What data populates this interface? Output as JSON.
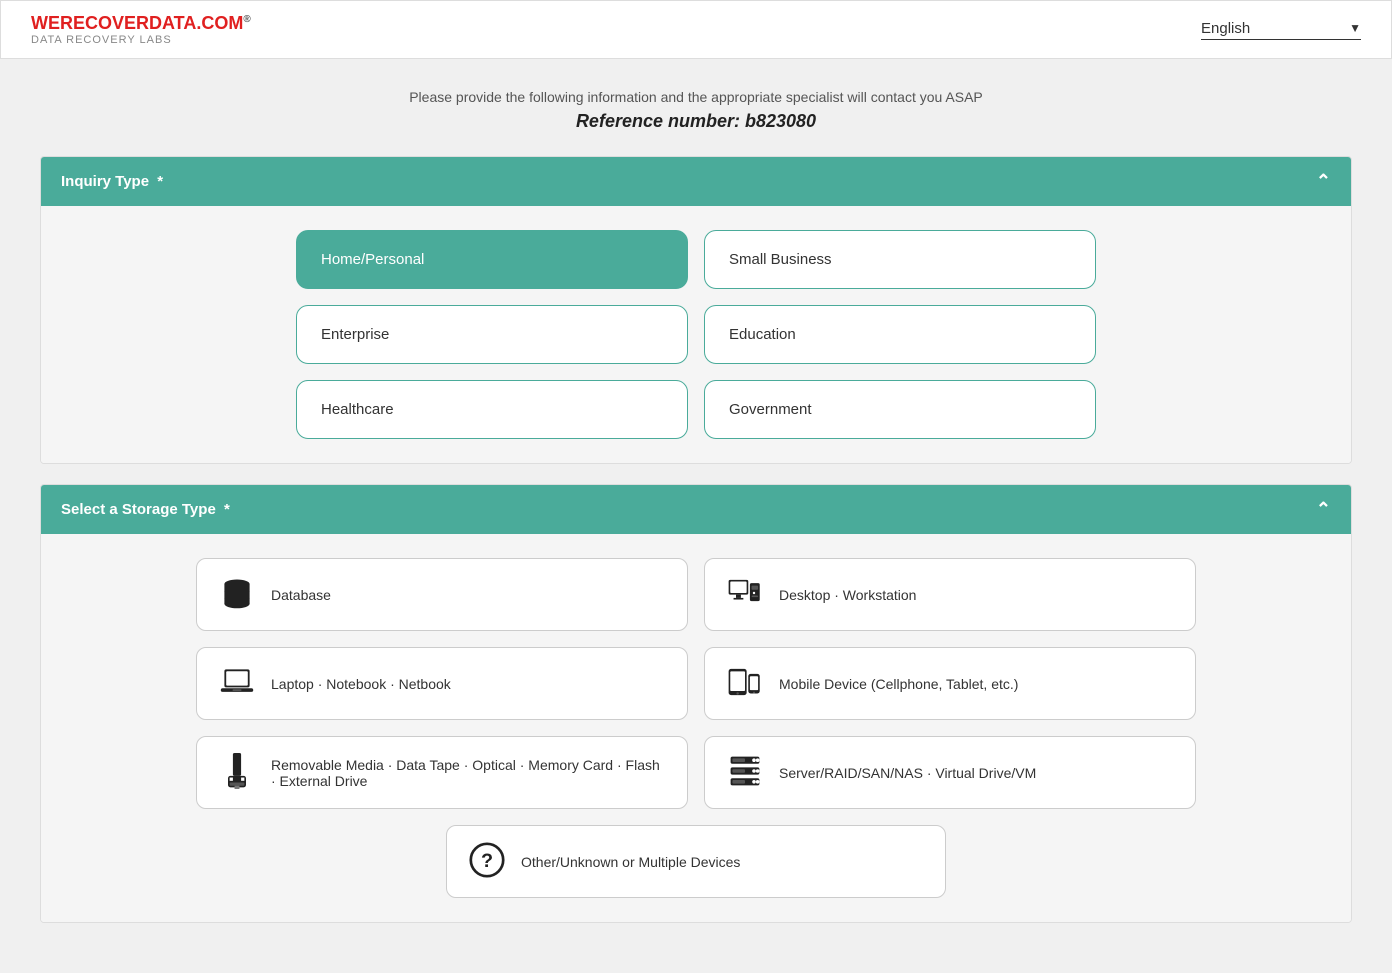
{
  "header": {
    "logo_we": "WE",
    "logo_recover": "RECOVER",
    "logo_data": "DATA.COM",
    "logo_reg": "®",
    "logo_sub": "DATA RECOVERY LABS",
    "language_label": "English",
    "language_arrow": "▼"
  },
  "intro": {
    "description": "Please provide the following information and the appropriate specialist will contact you ASAP",
    "ref_prefix": "Reference number: b823080"
  },
  "inquiry_section": {
    "title": "Inquiry Type",
    "required": "*",
    "chevron": "^",
    "buttons": [
      {
        "id": "home",
        "label": "Home/Personal",
        "active": true
      },
      {
        "id": "small-business",
        "label": "Small Business",
        "active": false
      },
      {
        "id": "enterprise",
        "label": "Enterprise",
        "active": false
      },
      {
        "id": "education",
        "label": "Education",
        "active": false
      },
      {
        "id": "healthcare",
        "label": "Healthcare",
        "active": false
      },
      {
        "id": "government",
        "label": "Government",
        "active": false
      }
    ]
  },
  "storage_section": {
    "title": "Select a Storage Type",
    "required": "*",
    "chevron": "^",
    "buttons": [
      {
        "id": "database",
        "label": "Database",
        "icon": "database"
      },
      {
        "id": "desktop",
        "label": "Desktop · Workstation",
        "icon": "desktop"
      },
      {
        "id": "laptop",
        "label": "Laptop · Notebook · Netbook",
        "icon": "laptop"
      },
      {
        "id": "mobile",
        "label": "Mobile Device (Cellphone, Tablet, etc.)",
        "icon": "mobile"
      },
      {
        "id": "removable",
        "label": "Removable Media · Data Tape · Optical · Memory Card · Flash · External Drive",
        "icon": "usb"
      },
      {
        "id": "server",
        "label": "Server/RAID/SAN/NAS · Virtual Drive/VM",
        "icon": "server"
      },
      {
        "id": "other",
        "label": "Other/Unknown or Multiple Devices",
        "icon": "question",
        "full": true
      }
    ]
  }
}
